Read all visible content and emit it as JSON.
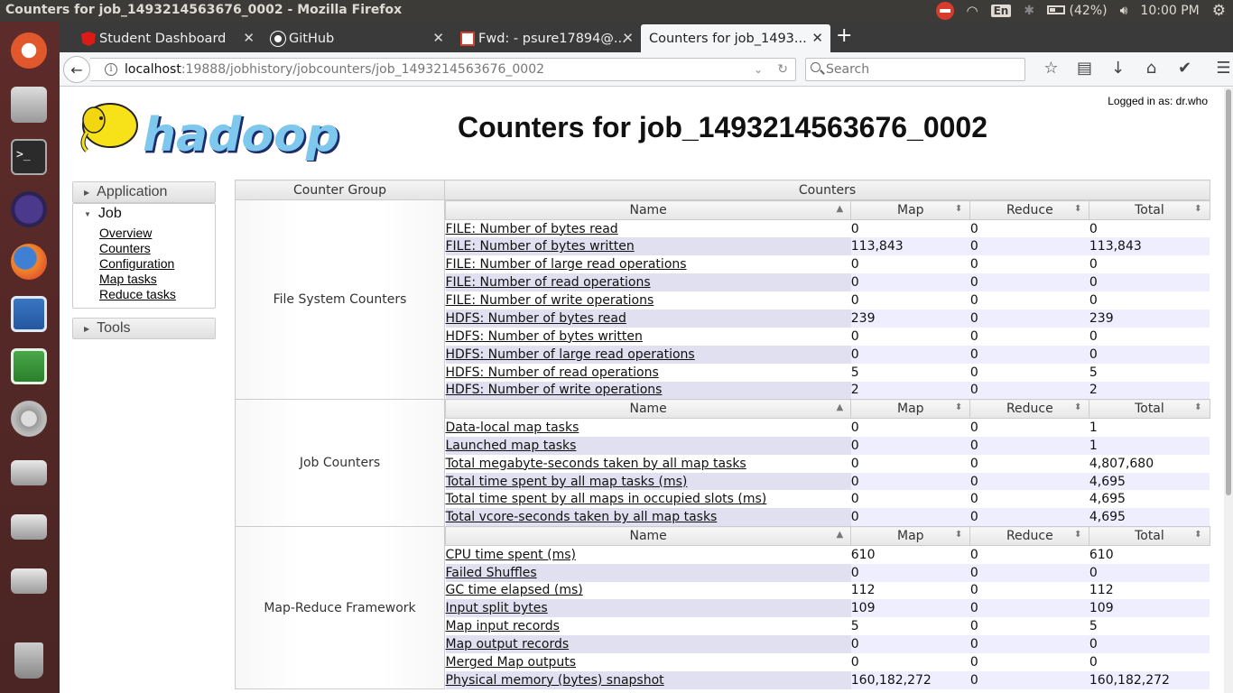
{
  "os": {
    "window_title": "Counters for job_1493214563676_0002 - Mozilla Firefox",
    "language": "En",
    "battery": "(42%)",
    "clock": "10:00 PM"
  },
  "browser": {
    "tabs": [
      {
        "title": "Student Dashboard"
      },
      {
        "title": "GitHub"
      },
      {
        "title": "Fwd: - psure17894@..."
      },
      {
        "title": "Counters for job_1493..."
      }
    ],
    "url_host": "localhost",
    "url_rest": ":19888/jobhistory/jobcounters/job_1493214563676_0002",
    "search_placeholder": "Search"
  },
  "page": {
    "logged_in": "Logged in as: dr.who",
    "title": "Counters for job_1493214563676_0002",
    "logo_text": "hadoop"
  },
  "nav": {
    "application": "Application",
    "job": "Job",
    "job_links": [
      "Overview",
      "Counters",
      "Configuration",
      "Map tasks",
      "Reduce tasks"
    ],
    "tools": "Tools"
  },
  "table": {
    "head_group": "Counter Group",
    "head_counters": "Counters",
    "col_name": "Name",
    "col_map": "Map",
    "col_reduce": "Reduce",
    "col_total": "Total",
    "groups": [
      {
        "name": "File System Counters",
        "rows": [
          [
            "FILE: Number of bytes read",
            "0",
            "0",
            "0"
          ],
          [
            "FILE: Number of bytes written",
            "113,843",
            "0",
            "113,843"
          ],
          [
            "FILE: Number of large read operations",
            "0",
            "0",
            "0"
          ],
          [
            "FILE: Number of read operations",
            "0",
            "0",
            "0"
          ],
          [
            "FILE: Number of write operations",
            "0",
            "0",
            "0"
          ],
          [
            "HDFS: Number of bytes read",
            "239",
            "0",
            "239"
          ],
          [
            "HDFS: Number of bytes written",
            "0",
            "0",
            "0"
          ],
          [
            "HDFS: Number of large read operations",
            "0",
            "0",
            "0"
          ],
          [
            "HDFS: Number of read operations",
            "5",
            "0",
            "5"
          ],
          [
            "HDFS: Number of write operations",
            "2",
            "0",
            "2"
          ]
        ]
      },
      {
        "name": "Job Counters",
        "rows": [
          [
            "Data-local map tasks",
            "0",
            "0",
            "1"
          ],
          [
            "Launched map tasks",
            "0",
            "0",
            "1"
          ],
          [
            "Total megabyte-seconds taken by all map tasks",
            "0",
            "0",
            "4,807,680"
          ],
          [
            "Total time spent by all map tasks (ms)",
            "0",
            "0",
            "4,695"
          ],
          [
            "Total time spent by all maps in occupied slots (ms)",
            "0",
            "0",
            "4,695"
          ],
          [
            "Total vcore-seconds taken by all map tasks",
            "0",
            "0",
            "4,695"
          ]
        ]
      },
      {
        "name": "Map-Reduce Framework",
        "rows": [
          [
            "CPU time spent (ms)",
            "610",
            "0",
            "610"
          ],
          [
            "Failed Shuffles",
            "0",
            "0",
            "0"
          ],
          [
            "GC time elapsed (ms)",
            "112",
            "0",
            "112"
          ],
          [
            "Input split bytes",
            "109",
            "0",
            "109"
          ],
          [
            "Map input records",
            "5",
            "0",
            "5"
          ],
          [
            "Map output records",
            "0",
            "0",
            "0"
          ],
          [
            "Merged Map outputs",
            "0",
            "0",
            "0"
          ],
          [
            "Physical memory (bytes) snapshot",
            "160,182,272",
            "0",
            "160,182,272"
          ]
        ]
      }
    ]
  }
}
